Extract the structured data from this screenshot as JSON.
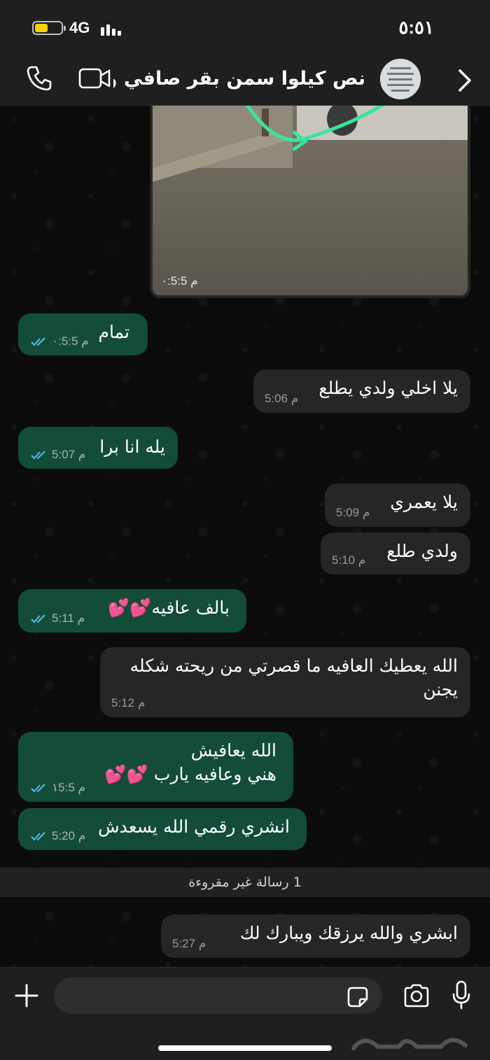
{
  "status_bar": {
    "time": "٥:٥١",
    "network": "4G",
    "battery_level": 0.5,
    "battery_color": "#f5d20c"
  },
  "header": {
    "title": "نص كيلوا سمن بقر صافي ونص...",
    "back_icon": "chevron-right-icon",
    "call_icon": "phone-icon",
    "video_icon": "video-camera-icon"
  },
  "media_message": {
    "time": "٠:5:5 م"
  },
  "messages": [
    {
      "dir": "out",
      "text": "تمام",
      "time": "٠:5:5 م",
      "read": true
    },
    {
      "dir": "in",
      "text": "يلا اخلي ولدي يطلع",
      "time": "5:06 م"
    },
    {
      "dir": "out",
      "text": "يله انا برا",
      "time": "5:07 م",
      "read": true
    },
    {
      "dir": "in",
      "text": "يلا يعمري",
      "time": "5:09 م"
    },
    {
      "dir": "in",
      "text": "ولدي طلع",
      "time": "5:10 م"
    },
    {
      "dir": "out",
      "text": "بالف عافيه💕💕",
      "time": "5:11 م",
      "read": true
    },
    {
      "dir": "in",
      "text": "الله يعطيك العافيه ما قصرتي من ريحته شكله\nيجنن",
      "time": "5:12 م"
    },
    {
      "dir": "out",
      "text": "الله يعافيش\nهني وعافيه يارب 💕💕",
      "time": "١5:5 م",
      "read": true
    },
    {
      "dir": "out",
      "text": "انشري  رقمي الله يسعدش",
      "time": "5:20 م",
      "read": true
    },
    {
      "dir": "in",
      "text": "ابشري والله يرزقك ويبارك لك",
      "time": "5:27 م"
    }
  ],
  "unread_divider": "1 رسالة غير مقروءة",
  "input_bar": {
    "message_placeholder": "",
    "plus_icon": "plus-icon",
    "sticker_icon": "sticker-icon",
    "camera_icon": "camera-icon",
    "mic_icon": "microphone-icon"
  },
  "colors": {
    "outgoing_bubble": "#134d37",
    "incoming_bubble": "#262626",
    "read_ticks": "#53bdeb"
  }
}
